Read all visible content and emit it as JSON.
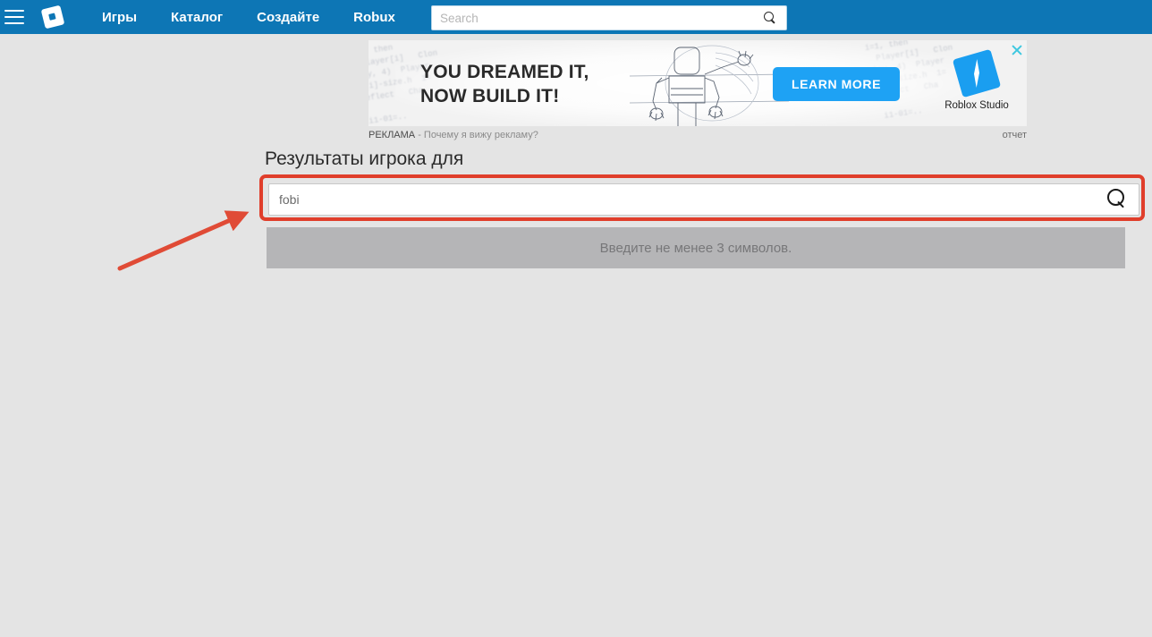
{
  "navbar": {
    "menu_icon": "hamburger-icon",
    "logo_icon": "roblox-logo-icon",
    "links": [
      {
        "label": "Игры"
      },
      {
        "label": "Каталог"
      },
      {
        "label": "Создайте"
      },
      {
        "label": "Robux"
      }
    ],
    "search": {
      "placeholder": "Search",
      "value": "",
      "icon": "search-icon"
    },
    "background_color": "#0d76b5"
  },
  "ad": {
    "headline_line1": "YOU DREAMED IT,",
    "headline_line2": "NOW BUILD IT!",
    "cta_label": "LEARN MORE",
    "cta_color": "#1ea2f4",
    "brand_label": "Roblox Studio",
    "brand_icon": "roblox-studio-icon",
    "close_icon": "close-icon",
    "close_color": "#3ec8e0",
    "label": "РЕКЛАМА",
    "why_link": "- Почему я вижу рекламу?",
    "report_link": "отчет",
    "code_texture_left": "i=1, then\n  Player[i]   Clon\nPlay, 4)  Player\nPl[i]-size.h  1=\n Reflect   Cha\n\n  i1-01=..",
    "rkt": "x"
  },
  "main": {
    "page_title": "Результаты игрока для",
    "player_search": {
      "value": "fobi",
      "placeholder": "",
      "icon": "search-icon"
    },
    "empty_message": "Введите не менее 3 символов.",
    "empty_message_bg": "#b5b5b7",
    "highlight_color": "#e03e2b"
  },
  "annotation": {
    "arrow_color": "#e04b36",
    "arrow_name": "red-pointer-arrow"
  }
}
